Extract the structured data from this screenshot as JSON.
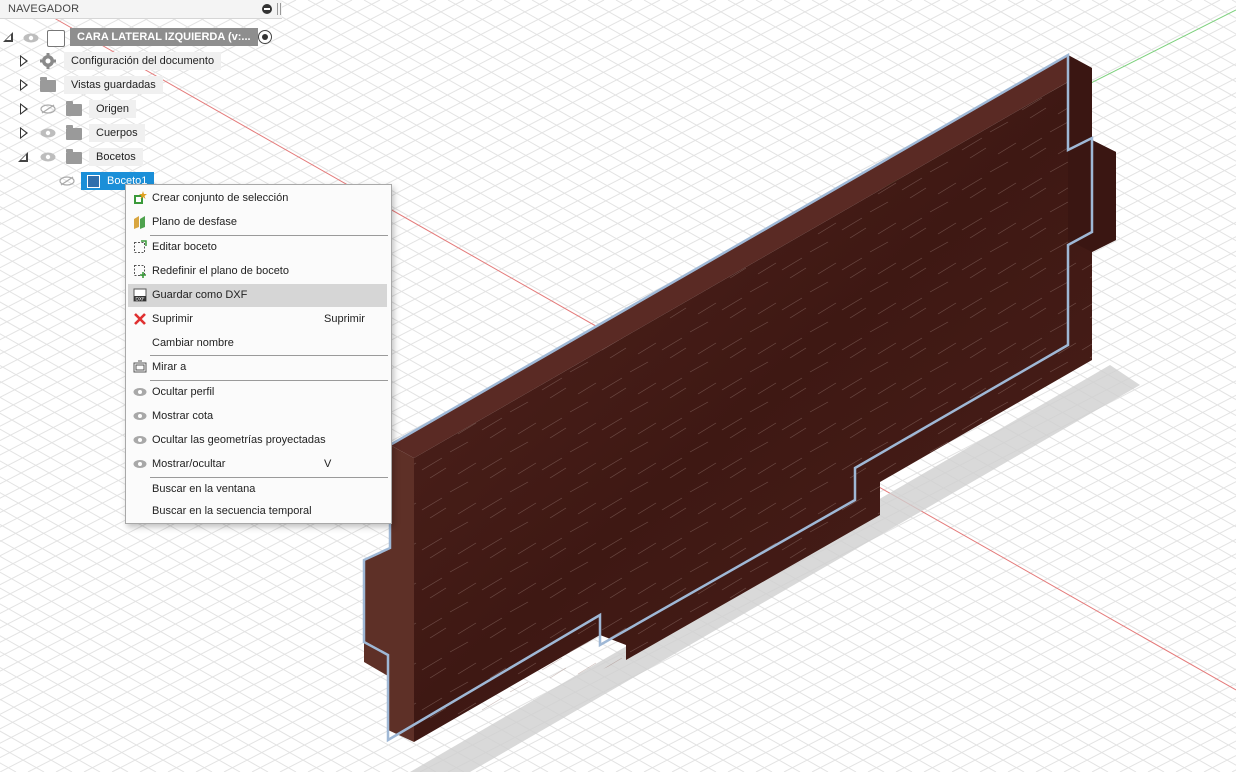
{
  "navigator": {
    "title": "NAVEGADOR",
    "root_label": "CARA LATERAL IZQUIERDA (v:...",
    "items": [
      {
        "label": "Configuración del documento"
      },
      {
        "label": "Vistas guardadas"
      },
      {
        "label": "Origen"
      },
      {
        "label": "Cuerpos"
      },
      {
        "label": "Bocetos"
      },
      {
        "label": "Boceto1"
      }
    ]
  },
  "context_menu": {
    "items": [
      {
        "label": "Crear conjunto de selección",
        "icon": "selection-set-icon"
      },
      {
        "label": "Plano de desfase",
        "icon": "offset-plane-icon"
      },
      {
        "label": "Editar boceto",
        "icon": "edit-sketch-icon"
      },
      {
        "label": "Redefinir el plano de boceto",
        "icon": "redefine-plane-icon"
      },
      {
        "label": "Guardar como DXF",
        "icon": "dxf-icon",
        "highlighted": true
      },
      {
        "label": "Suprimir",
        "icon": "delete-icon",
        "shortcut": "Suprimir"
      },
      {
        "label": "Cambiar nombre",
        "icon": ""
      },
      {
        "label": "Mirar a",
        "icon": "look-at-icon"
      },
      {
        "label": "Ocultar perfil",
        "icon": "eye-icon"
      },
      {
        "label": "Mostrar cota",
        "icon": "eye-icon"
      },
      {
        "label": "Ocultar las geometrías proyectadas",
        "icon": "eye-icon"
      },
      {
        "label": "Mostrar/ocultar",
        "icon": "eye-icon",
        "shortcut": "V"
      },
      {
        "label": "Buscar en la ventana",
        "icon": ""
      },
      {
        "label": "Buscar en la secuencia temporal",
        "icon": ""
      }
    ]
  },
  "colors": {
    "selection": "#1b8fd8",
    "menu_highlight": "#d6d6d6",
    "wood": "#4a1d17",
    "x_axis": "#e05050",
    "y_axis": "#3cb33c"
  }
}
